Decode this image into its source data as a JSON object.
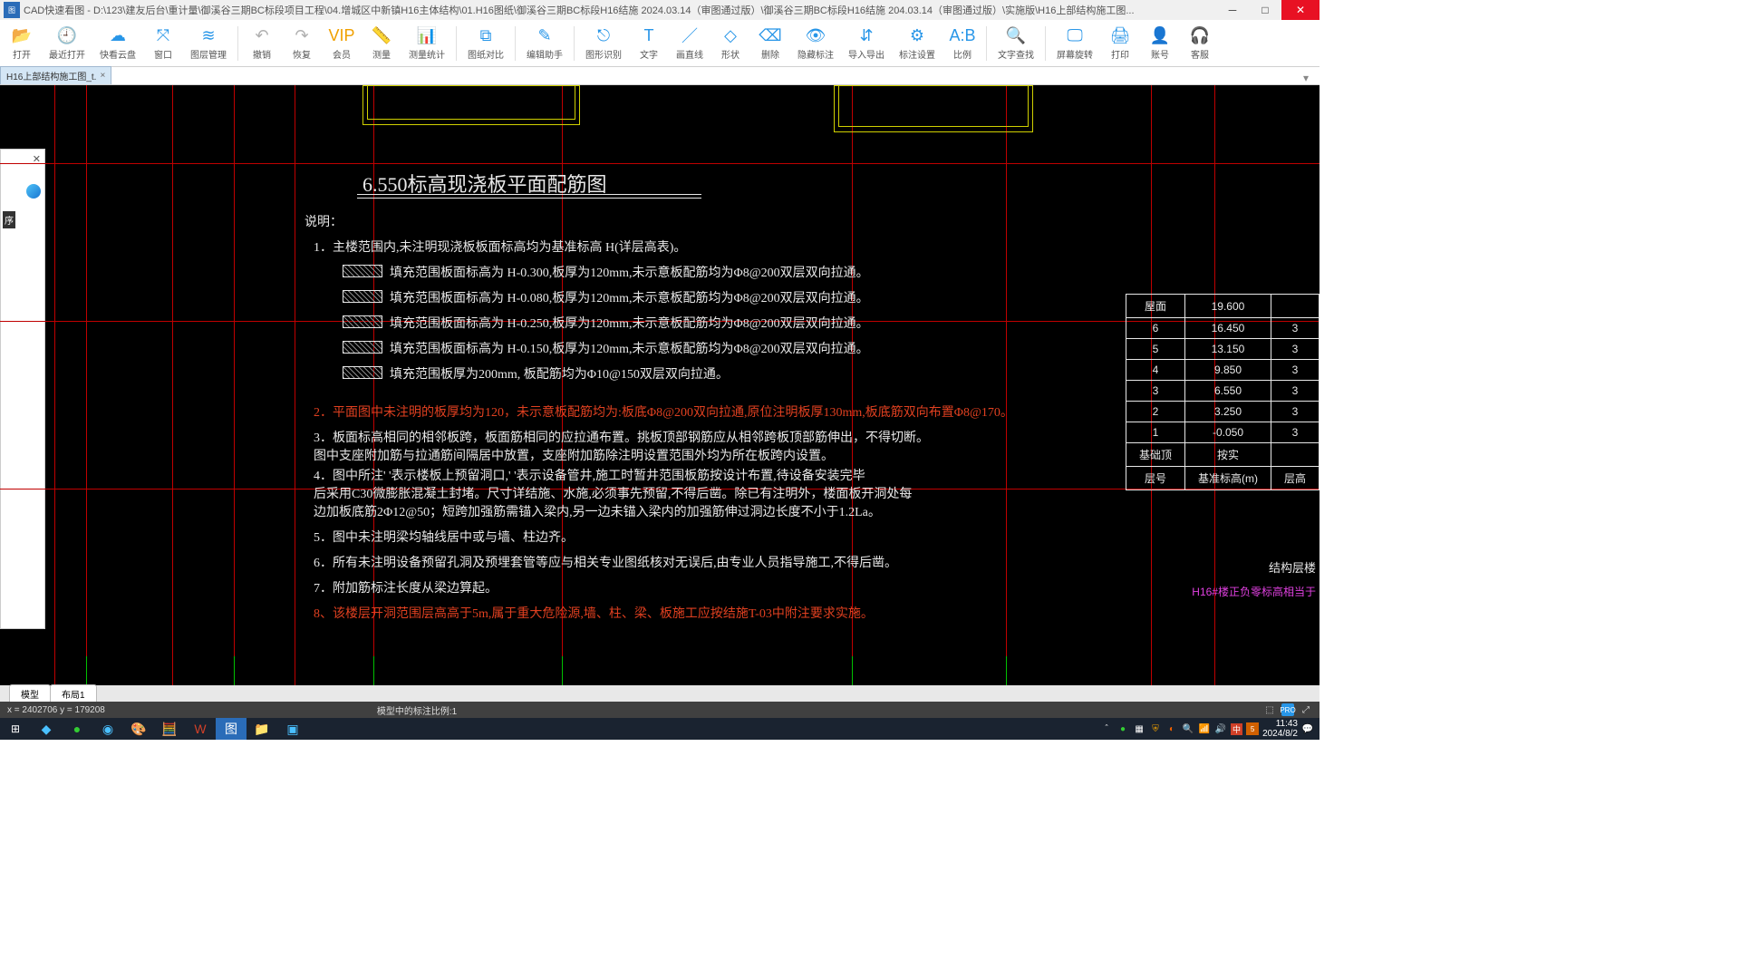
{
  "app_name": "CAD快速看图",
  "window_title": "CAD快速看图 - D:\\123\\建友后台\\重计量\\御溪谷三期BC标段项目工程\\04.增城区中新镇H16主体结构\\01.H16图纸\\御溪谷三期BC标段H16结施 2024.03.14（审图通过版）\\御溪谷三期BC标段H16结施 204.03.14（审图通过版）\\实施版\\H16上部结构施工图...",
  "toolbar": [
    {
      "icon": "📂",
      "label": "打开"
    },
    {
      "icon": "🕘",
      "label": "最近打开"
    },
    {
      "icon": "☁",
      "label": "快看云盘"
    },
    {
      "icon": "⤧",
      "label": "窗口"
    },
    {
      "icon": "≋",
      "label": "图层管理"
    },
    {
      "sep": true
    },
    {
      "icon": "↶",
      "label": "撤销",
      "grey": true
    },
    {
      "icon": "↷",
      "label": "恢复",
      "grey": true
    },
    {
      "icon": "VIP",
      "label": "会员",
      "vip": true
    },
    {
      "icon": "📏",
      "label": "测量"
    },
    {
      "icon": "📊",
      "label": "测量统计"
    },
    {
      "sep": true
    },
    {
      "icon": "⧉",
      "label": "图纸对比"
    },
    {
      "sep": true
    },
    {
      "icon": "✎",
      "label": "编辑助手"
    },
    {
      "sep": true
    },
    {
      "icon": "⎋",
      "label": "图形识别"
    },
    {
      "icon": "T",
      "label": "文字"
    },
    {
      "icon": "／",
      "label": "画直线"
    },
    {
      "icon": "◇",
      "label": "形状"
    },
    {
      "icon": "⌫",
      "label": "删除"
    },
    {
      "icon": "👁",
      "label": "隐藏标注"
    },
    {
      "icon": "⇵",
      "label": "导入导出"
    },
    {
      "icon": "⚙",
      "label": "标注设置"
    },
    {
      "icon": "A:B",
      "label": "比例"
    },
    {
      "sep": true
    },
    {
      "icon": "🔍",
      "label": "文字查找"
    },
    {
      "sep": true
    },
    {
      "icon": "🖵",
      "label": "屏幕旋转"
    },
    {
      "icon": "🖨",
      "label": "打印"
    },
    {
      "icon": "👤",
      "label": "账号"
    },
    {
      "icon": "🎧",
      "label": "客服"
    }
  ],
  "file_tab": "H16上部结构施工图_t.",
  "side_label": "序",
  "drawing": {
    "title": "6.550标高现浇板平面配筋图",
    "label_shuoming": "说明：",
    "note1": "1．主楼范围内,未注明现浇板板面标高均为基准标高 H(详层高表)。",
    "fill1": "填充范围板面标高为 H-0.300,板厚为120mm,未示意板配筋均为Φ8@200双层双向拉通。",
    "fill2": "填充范围板面标高为 H-0.080,板厚为120mm,未示意板配筋均为Φ8@200双层双向拉通。",
    "fill3": "填充范围板面标高为 H-0.250,板厚为120mm,未示意板配筋均为Φ8@200双层双向拉通。",
    "fill4": "填充范围板面标高为 H-0.150,板厚为120mm,未示意板配筋均为Φ8@200双层双向拉通。",
    "fill5": "填充范围板厚为200mm, 板配筋均为Φ10@150双层双向拉通。",
    "note2": "2．平面图中未注明的板厚均为120，未示意板配筋均为:板底Φ8@200双向拉通,原位注明板厚130mm,板底筋双向布置Φ8@170。",
    "note3a": "3．板面标高相同的相邻板跨，板面筋相同的应拉通布置。挑板顶部钢筋应从相邻跨板顶部筋伸出，不得切断。",
    "note3b": "    图中支座附加筋与拉通筋间隔居中放置，支座附加筋除注明设置范围外均为所在板跨内设置。",
    "note4a": "4．图中所注'     '表示楼板上预留洞口,'    '表示设备管井,施工时暂井范围板筋按设计布置,待设备安装完毕",
    "note4b": "    后采用C30微膨胀混凝土封堵。尺寸详结施、水施,必须事先预留,不得后凿。除已有注明外，楼面板开洞处每",
    "note4c": "    边加板底筋2Φ12@50；短跨加强筋需锚入梁内,另一边未锚入梁内的加强筋伸过洞边长度不小于1.2La。",
    "note5": "5．图中未注明梁均轴线居中或与墙、柱边齐。",
    "note6": "6．所有未注明设备预留孔洞及预埋套管等应与相关专业图纸核对无误后,由专业人员指导施工,不得后凿。",
    "note7": "7．附加筋标注长度从梁边算起。",
    "note8": "8、该楼层开洞范围层高高于5m,属于重大危险源,墙、柱、梁、板施工应按结施T-03中附注要求实施。"
  },
  "level_table": {
    "caption": "结构层楼",
    "note": "H16#楼正负零标高相当于",
    "rows": [
      [
        "屋面",
        "19.600",
        ""
      ],
      [
        "6",
        "16.450",
        "3"
      ],
      [
        "5",
        "13.150",
        "3"
      ],
      [
        "4",
        "9.850",
        "3"
      ],
      [
        "3",
        "6.550",
        "3"
      ],
      [
        "2",
        "3.250",
        "3"
      ],
      [
        "1",
        "-0.050",
        "3"
      ],
      [
        "基础顶",
        "按实",
        ""
      ],
      [
        "层号",
        "基准标高(m)",
        "层高"
      ]
    ]
  },
  "bottom_tabs": [
    "模型",
    "布局1"
  ],
  "status": {
    "coords": "x = 2402706  y = 179208",
    "scale": "模型中的标注比例:1",
    "pro": "PRO"
  },
  "clock": {
    "time": "11:43",
    "date": "2024/8/2"
  },
  "ime": "中"
}
